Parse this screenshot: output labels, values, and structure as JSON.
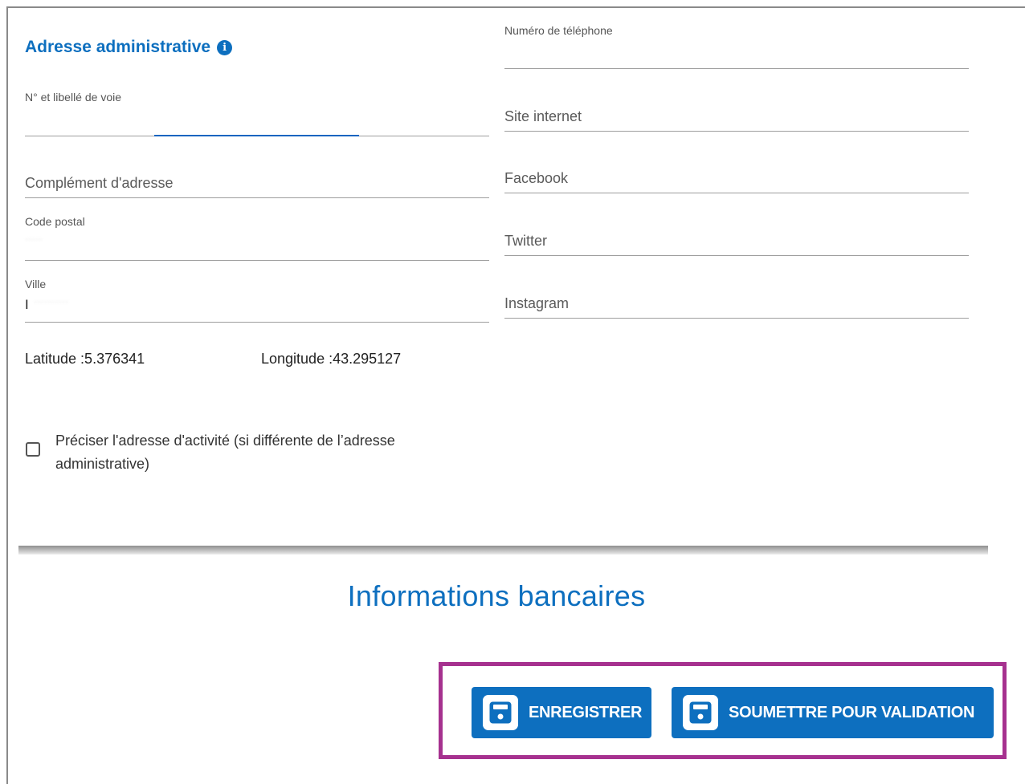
{
  "address": {
    "title": "Adresse administrative",
    "street_label": "N° et libellé de voie",
    "complement_placeholder": "Complément d'adresse",
    "postal_label": "Code postal",
    "city_label": "Ville",
    "city_value": "I"
  },
  "coordinates": {
    "latitude": "Latitude :5.376341",
    "longitude": "Longitude :43.295127"
  },
  "contact": {
    "phone_label": "Numéro de téléphone",
    "website_placeholder": "Site internet",
    "facebook_placeholder": "Facebook",
    "twitter_placeholder": "Twitter",
    "instagram_placeholder": "Instagram"
  },
  "activity_checkbox": {
    "label": "Préciser l'adresse d'activité (si différente de l’adresse administrative)",
    "checked": false
  },
  "banking": {
    "title": "Informations bancaires"
  },
  "actions": {
    "save_label": "ENREGISTRER",
    "submit_label": "SOUMETTRE POUR VALIDATION"
  },
  "colors": {
    "accent": "#0d6fbf",
    "highlight_border": "#a6318f",
    "focus_underline": "#1565c0"
  },
  "icons": {
    "info": "info-icon",
    "save": "floppy-disk-icon"
  }
}
